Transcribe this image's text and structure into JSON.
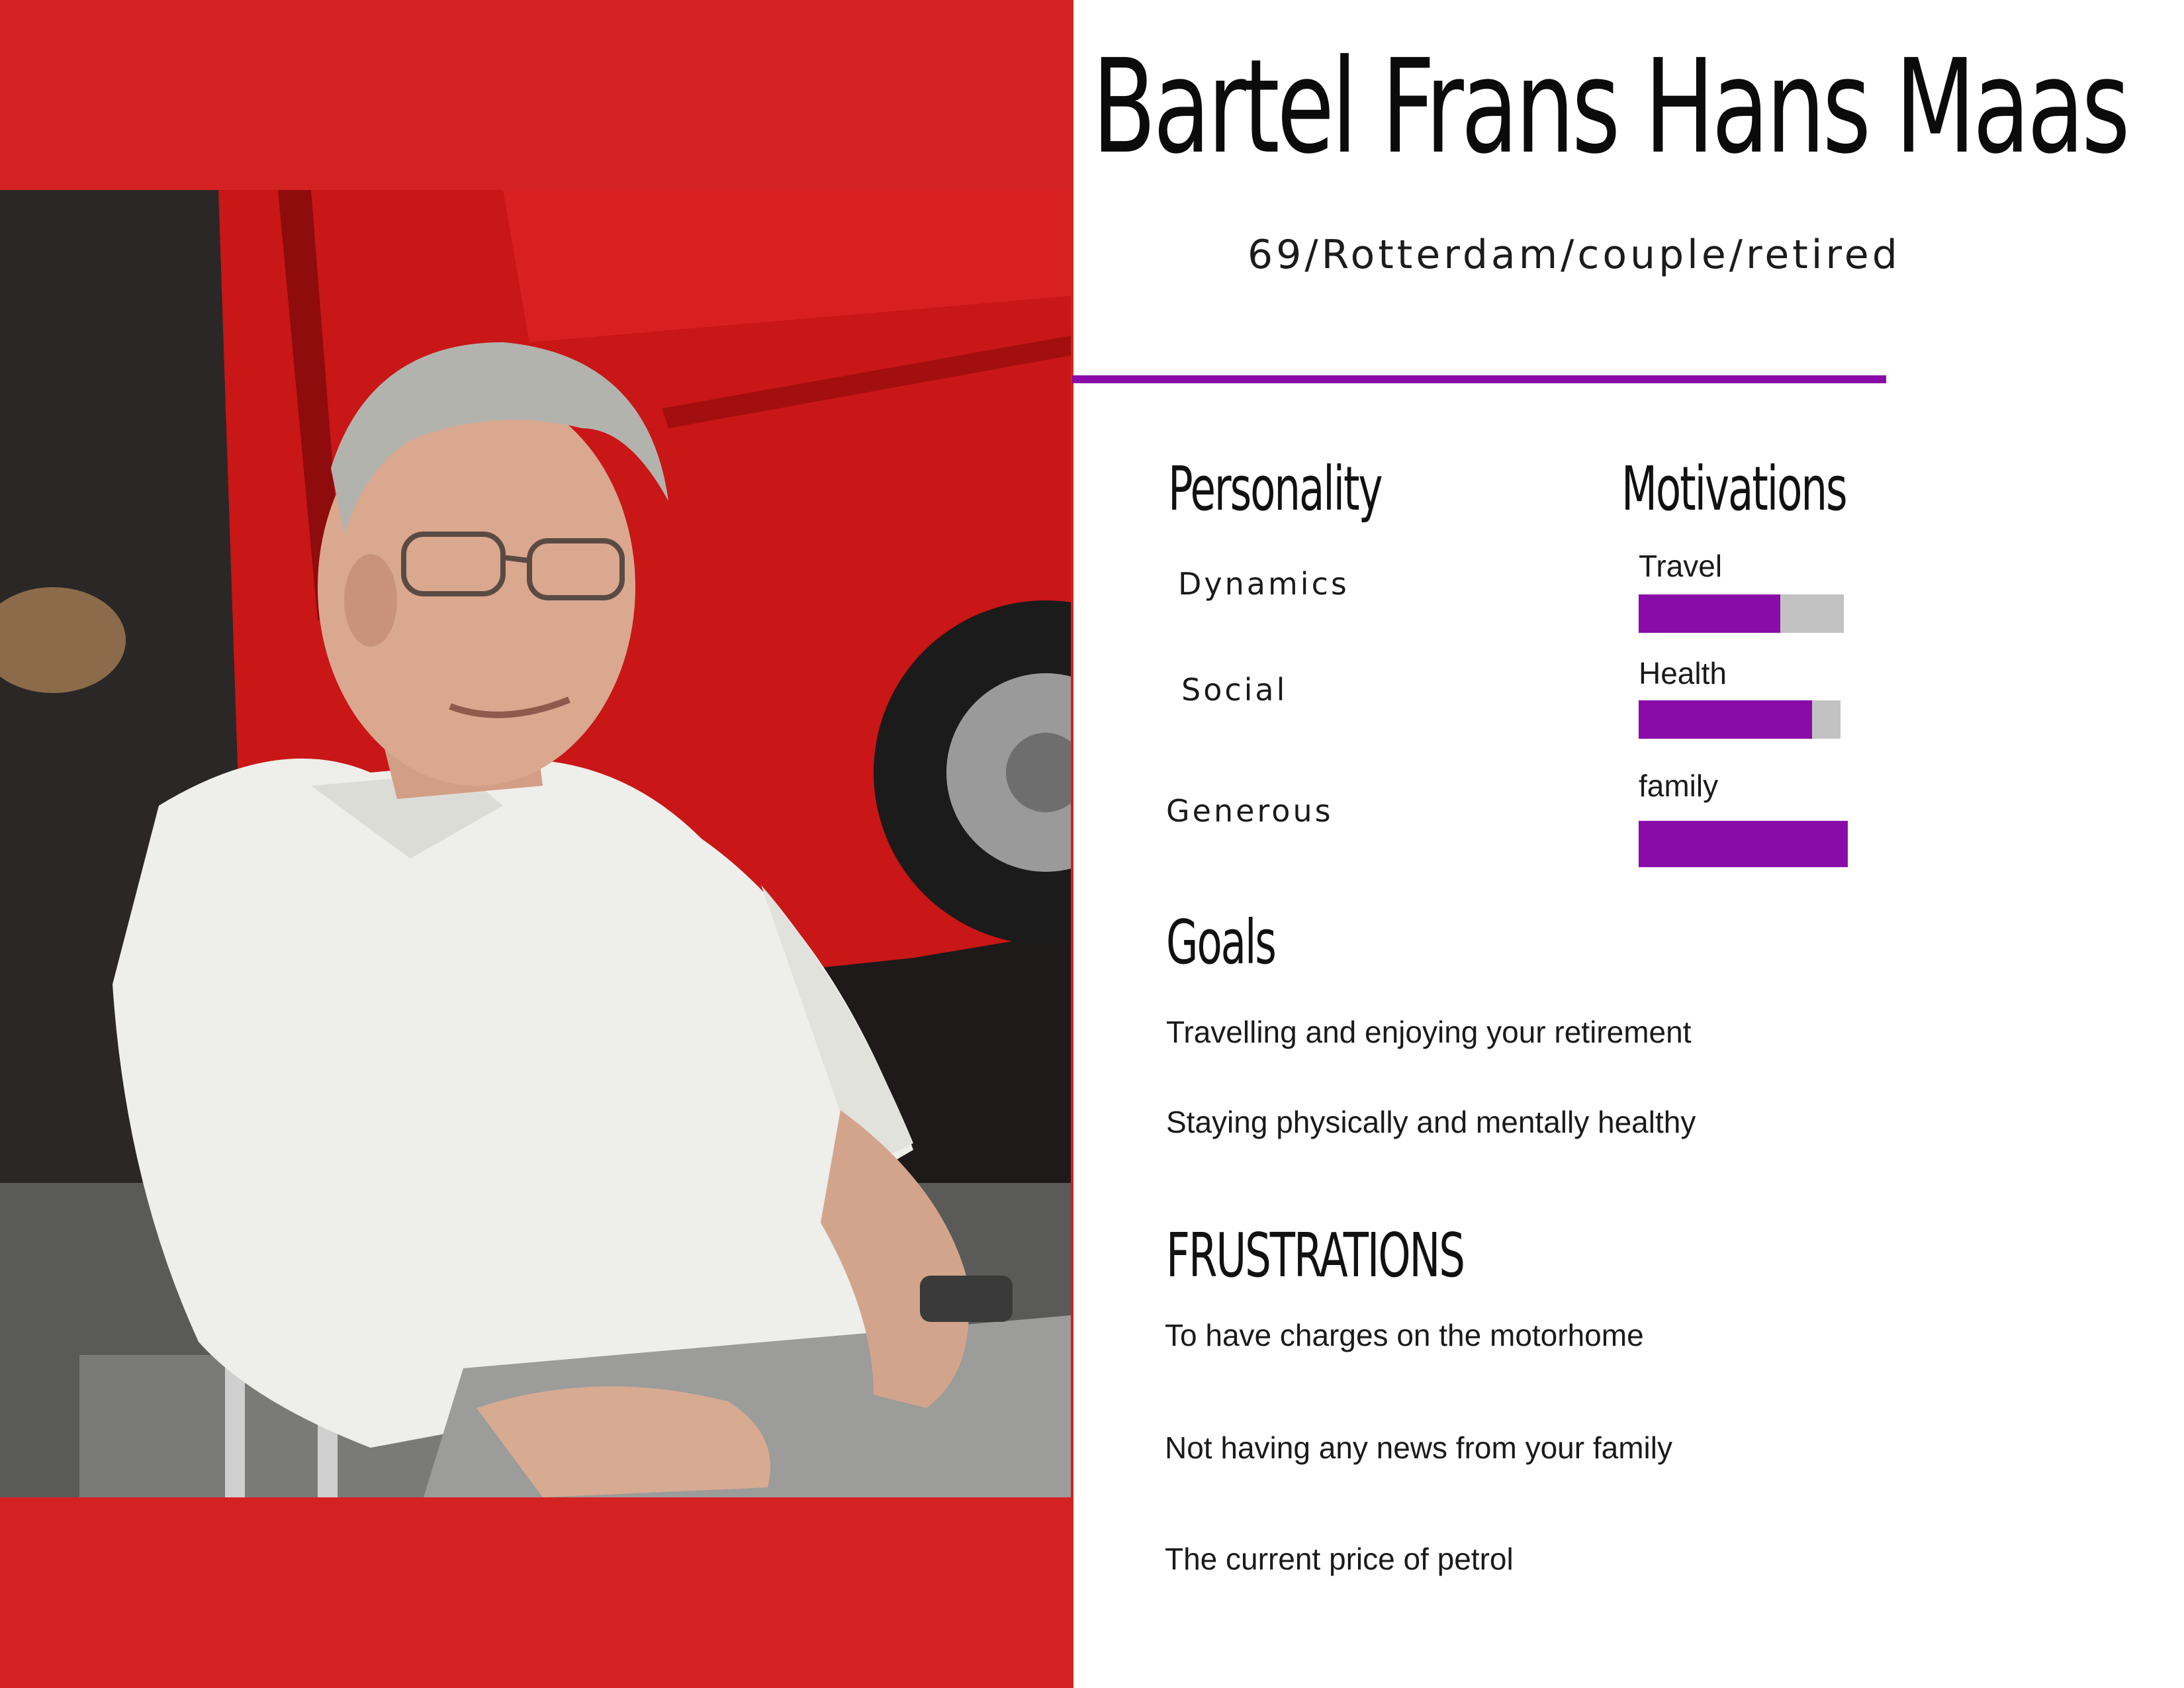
{
  "persona": {
    "name": "Bartel Frans Hans Maas",
    "subtitle": "69/Rotterdam/couple/retired"
  },
  "personality": {
    "heading": "Personality",
    "traits": [
      "Dynamics",
      "Social",
      "Generous"
    ]
  },
  "motivations": {
    "heading": "Motivations",
    "items": [
      {
        "label": "Travel",
        "level": 0.69
      },
      {
        "label": "Health",
        "level": 0.86
      },
      {
        "label": "family",
        "level": 1.0
      }
    ]
  },
  "goals": {
    "heading": "Goals",
    "items": [
      "Travelling  and enjoying your retirement",
      "Staying physically and mentally healthy"
    ]
  },
  "frustrations": {
    "heading": "FRUSTRATIONS",
    "items": [
      "To have charges on the motorhome",
      "Not having any news from your family",
      "The current price of petrol"
    ]
  },
  "colors": {
    "panel_red": "#d42222",
    "accent_purple": "#8a0ca8",
    "bar_track_grey": "#c2c2c2"
  }
}
